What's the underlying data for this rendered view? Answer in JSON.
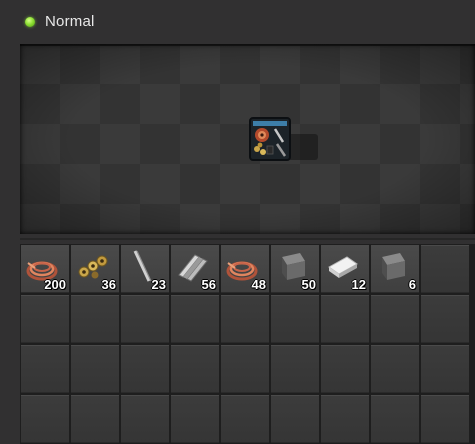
{
  "header": {
    "status_label": "Normal",
    "status_color": "#8ee033"
  },
  "preview": {
    "entity_icon": "assembling-machine-icon"
  },
  "inventory": {
    "rows": 4,
    "columns": 9,
    "slots": [
      {
        "item": "copper-cable",
        "icon": "copper-cable-icon",
        "count": "200"
      },
      {
        "item": "electronic-circuit",
        "icon": "circuit-icon",
        "count": "36"
      },
      {
        "item": "iron-stick",
        "icon": "iron-stick-icon",
        "count": "23"
      },
      {
        "item": "steel-beam",
        "icon": "steel-beam-icon",
        "count": "56"
      },
      {
        "item": "copper-cable",
        "icon": "copper-cable-icon",
        "count": "48"
      },
      {
        "item": "stone-block",
        "icon": "stone-block-icon",
        "count": "50"
      },
      {
        "item": "plastic-bar",
        "icon": "plastic-bar-icon",
        "count": "12"
      },
      {
        "item": "stone-block",
        "icon": "stone-block-icon",
        "count": "6"
      }
    ]
  }
}
